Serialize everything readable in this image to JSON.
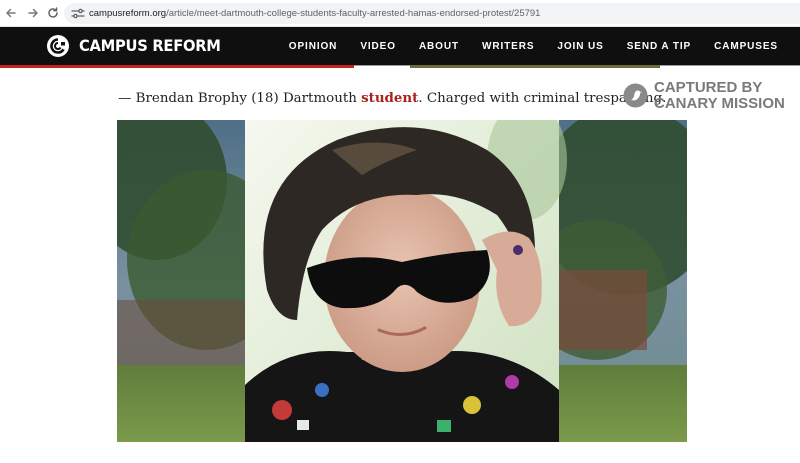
{
  "browser": {
    "back_icon": "arrow-left-icon",
    "forward_icon": "arrow-right-icon",
    "reload_icon": "reload-icon",
    "url_domain": "campusreform.org",
    "url_path": "/article/meet-dartmouth-college-students-faculty-arrested-hamas-endorsed-protest/25791"
  },
  "header": {
    "logo_text": "CAMPUS REFORM",
    "nav": [
      "OPINION",
      "VIDEO",
      "ABOUT",
      "WRITERS",
      "JOIN US",
      "SEND A TIP",
      "CAMPUSES"
    ],
    "accent_color": "#c3241f"
  },
  "caption": {
    "prefix": "— Brendan Brophy (18) Dartmouth ",
    "link": "student",
    "suffix": ". Charged with criminal trespassing."
  },
  "watermark": {
    "line1": "CAPTURED BY",
    "line2": "CANARY MISSION"
  }
}
